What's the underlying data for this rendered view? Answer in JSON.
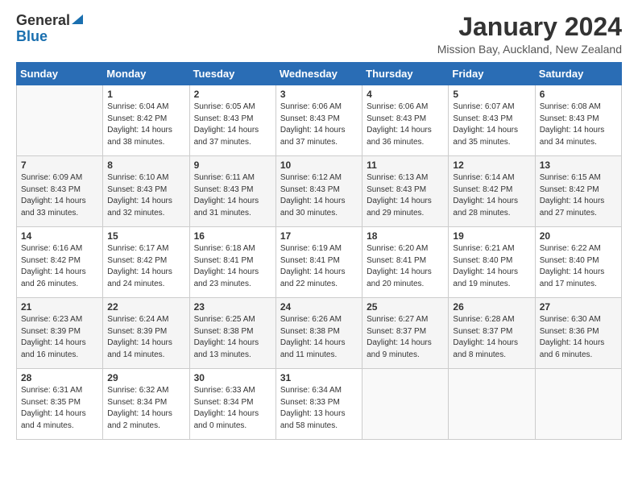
{
  "header": {
    "logo_general": "General",
    "logo_blue": "Blue",
    "month": "January 2024",
    "location": "Mission Bay, Auckland, New Zealand"
  },
  "days_of_week": [
    "Sunday",
    "Monday",
    "Tuesday",
    "Wednesday",
    "Thursday",
    "Friday",
    "Saturday"
  ],
  "weeks": [
    [
      {
        "num": "",
        "info": ""
      },
      {
        "num": "1",
        "info": "Sunrise: 6:04 AM\nSunset: 8:42 PM\nDaylight: 14 hours\nand 38 minutes."
      },
      {
        "num": "2",
        "info": "Sunrise: 6:05 AM\nSunset: 8:43 PM\nDaylight: 14 hours\nand 37 minutes."
      },
      {
        "num": "3",
        "info": "Sunrise: 6:06 AM\nSunset: 8:43 PM\nDaylight: 14 hours\nand 37 minutes."
      },
      {
        "num": "4",
        "info": "Sunrise: 6:06 AM\nSunset: 8:43 PM\nDaylight: 14 hours\nand 36 minutes."
      },
      {
        "num": "5",
        "info": "Sunrise: 6:07 AM\nSunset: 8:43 PM\nDaylight: 14 hours\nand 35 minutes."
      },
      {
        "num": "6",
        "info": "Sunrise: 6:08 AM\nSunset: 8:43 PM\nDaylight: 14 hours\nand 34 minutes."
      }
    ],
    [
      {
        "num": "7",
        "info": "Sunrise: 6:09 AM\nSunset: 8:43 PM\nDaylight: 14 hours\nand 33 minutes."
      },
      {
        "num": "8",
        "info": "Sunrise: 6:10 AM\nSunset: 8:43 PM\nDaylight: 14 hours\nand 32 minutes."
      },
      {
        "num": "9",
        "info": "Sunrise: 6:11 AM\nSunset: 8:43 PM\nDaylight: 14 hours\nand 31 minutes."
      },
      {
        "num": "10",
        "info": "Sunrise: 6:12 AM\nSunset: 8:43 PM\nDaylight: 14 hours\nand 30 minutes."
      },
      {
        "num": "11",
        "info": "Sunrise: 6:13 AM\nSunset: 8:43 PM\nDaylight: 14 hours\nand 29 minutes."
      },
      {
        "num": "12",
        "info": "Sunrise: 6:14 AM\nSunset: 8:42 PM\nDaylight: 14 hours\nand 28 minutes."
      },
      {
        "num": "13",
        "info": "Sunrise: 6:15 AM\nSunset: 8:42 PM\nDaylight: 14 hours\nand 27 minutes."
      }
    ],
    [
      {
        "num": "14",
        "info": "Sunrise: 6:16 AM\nSunset: 8:42 PM\nDaylight: 14 hours\nand 26 minutes."
      },
      {
        "num": "15",
        "info": "Sunrise: 6:17 AM\nSunset: 8:42 PM\nDaylight: 14 hours\nand 24 minutes."
      },
      {
        "num": "16",
        "info": "Sunrise: 6:18 AM\nSunset: 8:41 PM\nDaylight: 14 hours\nand 23 minutes."
      },
      {
        "num": "17",
        "info": "Sunrise: 6:19 AM\nSunset: 8:41 PM\nDaylight: 14 hours\nand 22 minutes."
      },
      {
        "num": "18",
        "info": "Sunrise: 6:20 AM\nSunset: 8:41 PM\nDaylight: 14 hours\nand 20 minutes."
      },
      {
        "num": "19",
        "info": "Sunrise: 6:21 AM\nSunset: 8:40 PM\nDaylight: 14 hours\nand 19 minutes."
      },
      {
        "num": "20",
        "info": "Sunrise: 6:22 AM\nSunset: 8:40 PM\nDaylight: 14 hours\nand 17 minutes."
      }
    ],
    [
      {
        "num": "21",
        "info": "Sunrise: 6:23 AM\nSunset: 8:39 PM\nDaylight: 14 hours\nand 16 minutes."
      },
      {
        "num": "22",
        "info": "Sunrise: 6:24 AM\nSunset: 8:39 PM\nDaylight: 14 hours\nand 14 minutes."
      },
      {
        "num": "23",
        "info": "Sunrise: 6:25 AM\nSunset: 8:38 PM\nDaylight: 14 hours\nand 13 minutes."
      },
      {
        "num": "24",
        "info": "Sunrise: 6:26 AM\nSunset: 8:38 PM\nDaylight: 14 hours\nand 11 minutes."
      },
      {
        "num": "25",
        "info": "Sunrise: 6:27 AM\nSunset: 8:37 PM\nDaylight: 14 hours\nand 9 minutes."
      },
      {
        "num": "26",
        "info": "Sunrise: 6:28 AM\nSunset: 8:37 PM\nDaylight: 14 hours\nand 8 minutes."
      },
      {
        "num": "27",
        "info": "Sunrise: 6:30 AM\nSunset: 8:36 PM\nDaylight: 14 hours\nand 6 minutes."
      }
    ],
    [
      {
        "num": "28",
        "info": "Sunrise: 6:31 AM\nSunset: 8:35 PM\nDaylight: 14 hours\nand 4 minutes."
      },
      {
        "num": "29",
        "info": "Sunrise: 6:32 AM\nSunset: 8:34 PM\nDaylight: 14 hours\nand 2 minutes."
      },
      {
        "num": "30",
        "info": "Sunrise: 6:33 AM\nSunset: 8:34 PM\nDaylight: 14 hours\nand 0 minutes."
      },
      {
        "num": "31",
        "info": "Sunrise: 6:34 AM\nSunset: 8:33 PM\nDaylight: 13 hours\nand 58 minutes."
      },
      {
        "num": "",
        "info": ""
      },
      {
        "num": "",
        "info": ""
      },
      {
        "num": "",
        "info": ""
      }
    ]
  ]
}
